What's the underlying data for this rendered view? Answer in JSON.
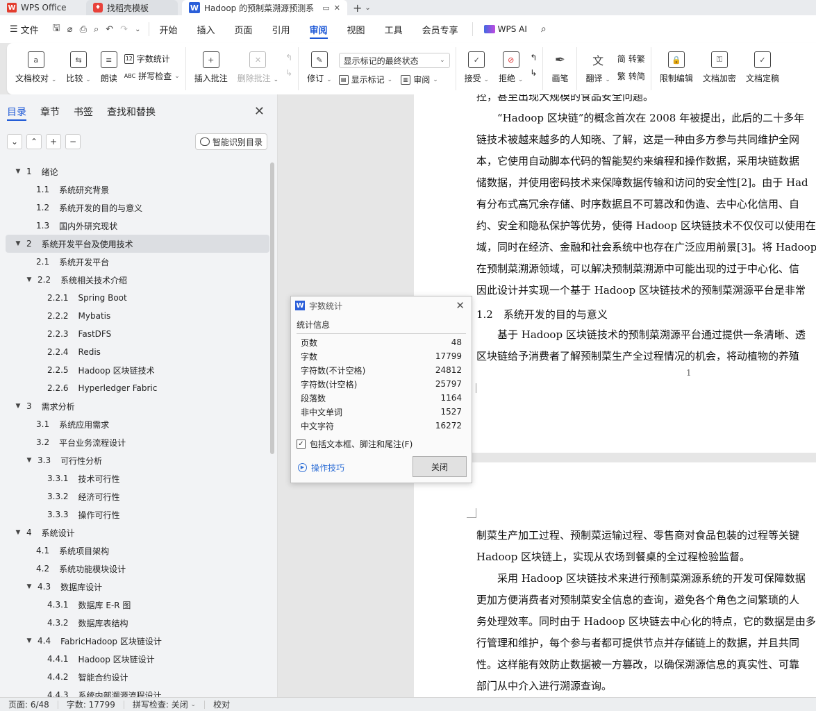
{
  "tabs": {
    "wps": "WPS Office",
    "docer": "找稻壳模板",
    "doc": "Hadoop 的预制菜溯源预测系"
  },
  "menu": {
    "file": "文件",
    "items": [
      "开始",
      "插入",
      "页面",
      "引用",
      "审阅",
      "视图",
      "工具",
      "会员专享"
    ],
    "active": "审阅",
    "wps_ai": "WPS AI"
  },
  "ribbon": {
    "proofread": "文档校对",
    "compare": "比较",
    "read_aloud": "朗读",
    "word_count": "字数统计",
    "spell_check": "拼写检查",
    "insert_comment": "插入批注",
    "delete_comment": "删除批注",
    "revise": "修订",
    "markup_select": "显示标记的最终状态",
    "show_markup": "显示标记",
    "review": "审阅",
    "accept": "接受",
    "reject": "拒绝",
    "pen": "画笔",
    "translate": "翻译",
    "to_traditional": "转繁",
    "to_simplified": "转简",
    "restrict_edit": "限制编辑",
    "encrypt": "文档加密",
    "finalize": "文档定稿"
  },
  "nav": {
    "tabs": [
      "目录",
      "章节",
      "书签",
      "查找和替换"
    ],
    "smart_toc": "智能识别目录",
    "toc": [
      {
        "level": 1,
        "num": "1",
        "title": "绪论",
        "expanded": true
      },
      {
        "level": 2,
        "num": "1.1",
        "title": "系统研究背景"
      },
      {
        "level": 2,
        "num": "1.2",
        "title": "系统开发的目的与意义"
      },
      {
        "level": 2,
        "num": "1.3",
        "title": "国内外研究现状"
      },
      {
        "level": 1,
        "num": "2",
        "title": "系统开发平台及使用技术",
        "expanded": true,
        "selected": true
      },
      {
        "level": 2,
        "num": "2.1",
        "title": "系统开发平台"
      },
      {
        "level": 2,
        "num": "2.2",
        "title": "系统相关技术介绍",
        "expanded": true
      },
      {
        "level": 3,
        "num": "2.2.1",
        "title": "Spring Boot"
      },
      {
        "level": 3,
        "num": "2.2.2",
        "title": "Mybatis"
      },
      {
        "level": 3,
        "num": "2.2.3",
        "title": "FastDFS"
      },
      {
        "level": 3,
        "num": "2.2.4",
        "title": "Redis"
      },
      {
        "level": 3,
        "num": "2.2.5",
        "title": "Hadoop 区块链技术"
      },
      {
        "level": 3,
        "num": "2.2.6",
        "title": "Hyperledger Fabric"
      },
      {
        "level": 1,
        "num": "3",
        "title": "需求分析",
        "expanded": true
      },
      {
        "level": 2,
        "num": "3.1",
        "title": "系统应用需求"
      },
      {
        "level": 2,
        "num": "3.2",
        "title": "平台业务流程设计"
      },
      {
        "level": 2,
        "num": "3.3",
        "title": "可行性分析",
        "expanded": true
      },
      {
        "level": 3,
        "num": "3.3.1",
        "title": "技术可行性"
      },
      {
        "level": 3,
        "num": "3.3.2",
        "title": "经济可行性"
      },
      {
        "level": 3,
        "num": "3.3.3",
        "title": "操作可行性"
      },
      {
        "level": 1,
        "num": "4",
        "title": "系统设计",
        "expanded": true
      },
      {
        "level": 2,
        "num": "4.1",
        "title": "系统项目架构"
      },
      {
        "level": 2,
        "num": "4.2",
        "title": "系统功能模块设计"
      },
      {
        "level": 2,
        "num": "4.3",
        "title": "数据库设计",
        "expanded": true
      },
      {
        "level": 3,
        "num": "4.3.1",
        "title": "数据库 E-R 图"
      },
      {
        "level": 3,
        "num": "4.3.2",
        "title": "数据库表结构"
      },
      {
        "level": 2,
        "num": "4.4",
        "title": "FabricHadoop 区块链设计",
        "expanded": true
      },
      {
        "level": 3,
        "num": "4.4.1",
        "title": "Hadoop 区块链设计"
      },
      {
        "level": 3,
        "num": "4.4.2",
        "title": "智能合约设计"
      },
      {
        "level": 3,
        "num": "4.4.3",
        "title": "系统内部溯源流程设计"
      }
    ]
  },
  "document": {
    "page1_lines": [
      "控，甚至出现大规模的食品安全问题。",
      "　　“Hadoop 区块链”的概念首次在 2008 年被提出，此后的二十多年",
      "链技术被越来越多的人知晓、了解，这是一种由多方参与共同维护全网",
      "本，它使用自动脚本代码的智能契约来编程和操作数据，采用块链数据",
      "储数据，并使用密码技术来保障数据传输和访问的安全性[2]。由于 Had",
      "有分布式高冗余存储、时序数据且不可篡改和伪造、去中心化信用、自",
      "约、安全和隐私保护等优势，使得 Hadoop 区块链技术不仅仅可以使用在",
      "域，同时在经济、金融和社会系统中也存在广泛应用前景[3]。将 Hadoop",
      "在预制菜溯源领域，可以解决预制菜溯源中可能出现的过于中心化、信",
      "因此设计并实现一个基于 Hadoop 区块链技术的预制菜溯源平台是非常"
    ],
    "heading": "1.2　系统开发的目的与意义",
    "page1_after": [
      "　　基于 Hadoop 区块链技术的预制菜溯源平台通过提供一条清晰、透",
      "区块链给予消费者了解预制菜生产全过程情况的机会，将动植物的养殖"
    ],
    "page_number": "1",
    "page2_lines": [
      "制菜生产加工过程、预制菜运输过程、零售商对食品包装的过程等关键",
      "Hadoop 区块链上，实现从农场到餐桌的全过程检验监督。",
      "　　采用 Hadoop 区块链技术来进行预制菜溯源系统的开发可保障数据",
      "更加方便消费者对预制菜安全信息的查询，避免各个角色之间繁琐的人",
      "务处理效率。同时由于 Hadoop 区块链去中心化的特点，它的数据是由多",
      "行管理和维护，每个参与者都可提供节点并存储链上的数据，并且共同",
      "性。这样能有效防止数据被一方篡改，以确保溯源信息的真实性、可靠",
      "部门从中介入进行溯源查询。"
    ]
  },
  "dialog": {
    "title": "字数统计",
    "section": "统计信息",
    "stats": [
      {
        "label": "页数",
        "value": "48"
      },
      {
        "label": "字数",
        "value": "17799"
      },
      {
        "label": "字符数(不计空格)",
        "value": "24812"
      },
      {
        "label": "字符数(计空格)",
        "value": "25797"
      },
      {
        "label": "段落数",
        "value": "1164"
      },
      {
        "label": "非中文单词",
        "value": "1527"
      },
      {
        "label": "中文字符",
        "value": "16272"
      }
    ],
    "checkbox_label": "包括文本框、脚注和尾注(F)",
    "checkbox_checked": true,
    "tips": "操作技巧",
    "close": "关闭"
  },
  "status": {
    "page": "页面: 6/48",
    "words": "字数: 17799",
    "spell": "拼写检查: 关闭",
    "proof": "校对"
  }
}
